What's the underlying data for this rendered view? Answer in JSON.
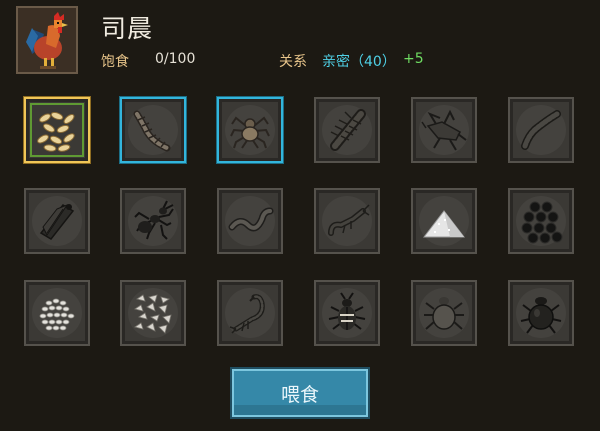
{
  "character": {
    "name": "司晨",
    "portrait_icon": "rooster-icon"
  },
  "stats": {
    "satiety_label": "饱食",
    "satiety_value": "0/100",
    "relation_label": "关系",
    "relation_value": "亲密（40）",
    "relation_bonus": "+5"
  },
  "colors": {
    "accent_gold": "#f0c658",
    "accent_blue": "#33b5dc",
    "relation_cyan": "#4fd0e6",
    "bonus_green": "#6fdc62"
  },
  "items": [
    {
      "icon": "grain-pile-icon",
      "state": "selected-gold"
    },
    {
      "icon": "centipede-icon",
      "state": "highlight-blue"
    },
    {
      "icon": "spider-icon",
      "state": "highlight-blue"
    },
    {
      "icon": "caterpillar-icon",
      "state": "dim"
    },
    {
      "icon": "grasshopper-icon",
      "state": "dim"
    },
    {
      "icon": "larva-worm-icon",
      "state": "dim"
    },
    {
      "icon": "cicada-icon",
      "state": "dim"
    },
    {
      "icon": "ant-icon",
      "state": "dim"
    },
    {
      "icon": "earthworm-icon",
      "state": "dim"
    },
    {
      "icon": "shrimp-icon",
      "state": "dim"
    },
    {
      "icon": "white-powder-pile-icon",
      "state": "dim"
    },
    {
      "icon": "dark-berries-icon",
      "state": "dim"
    },
    {
      "icon": "rice-grain-pile-icon",
      "state": "dim"
    },
    {
      "icon": "seed-pile-icon",
      "state": "dim"
    },
    {
      "icon": "scorpion-icon",
      "state": "dim"
    },
    {
      "icon": "beetle-icon",
      "state": "dim"
    },
    {
      "icon": "tick-icon",
      "state": "dim"
    },
    {
      "icon": "dung-beetle-icon",
      "state": "dim"
    }
  ],
  "actions": {
    "feed_label": "喂食"
  }
}
